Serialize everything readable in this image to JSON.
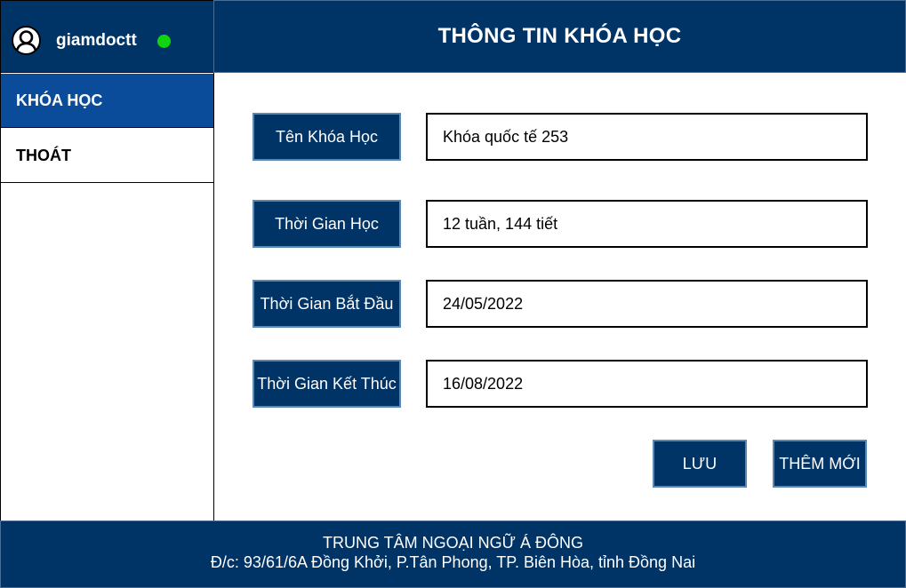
{
  "sidebar": {
    "username": "giamdoctt",
    "status_color": "#11d411",
    "avatar_icon": "user-circle-icon",
    "items": [
      {
        "label": "KHÓA HỌC",
        "active": true
      },
      {
        "label": "THOÁT",
        "active": false
      }
    ]
  },
  "header": {
    "title": "THÔNG TIN KHÓA HỌC"
  },
  "form": {
    "fields": [
      {
        "label": "Tên Khóa Học",
        "value": "Khóa quốc tế 253"
      },
      {
        "label": "Thời Gian Học",
        "value": "12 tuần, 144 tiết"
      },
      {
        "label": "Thời Gian Bắt Đầu",
        "value": "24/05/2022"
      },
      {
        "label": "Thời Gian Kết Thúc",
        "value": "16/08/2022"
      }
    ],
    "save_label": "LƯU",
    "new_label": "THÊM MỚI"
  },
  "footer": {
    "name": "TRUNG TÂM NGOẠI NGỮ Á ĐÔNG",
    "address": "Đ/c: 93/61/6A Đồng Khởi, P.Tân Phong, TP. Biên Hòa, tỉnh Đồng Nai"
  },
  "colors": {
    "primary": "#003366",
    "active_nav": "#0a4c9a",
    "label_border": "#5b87b3"
  }
}
